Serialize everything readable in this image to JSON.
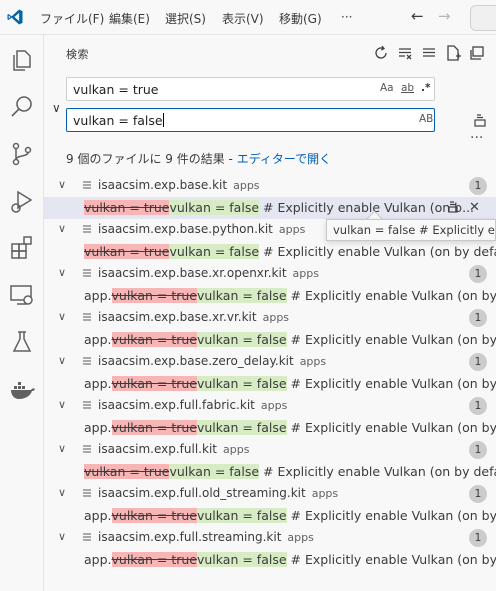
{
  "titlebar": {
    "menu": [
      "ファイル(F)",
      "編集(E)",
      "選択(S)",
      "表示(V)",
      "移動(G)",
      "···"
    ],
    "back_icon": "arrow-left-icon",
    "forward_icon": "arrow-right-icon"
  },
  "activity_bar": [
    "explorer-icon",
    "search-icon",
    "source-control-icon",
    "run-debug-icon",
    "extensions-icon",
    "remote-explorer-icon",
    "testing-icon",
    "docker-icon"
  ],
  "search": {
    "title": "検索",
    "find_value": "vulkan = true",
    "replace_value": "vulkan = false",
    "find_options": [
      "Aa",
      "ab",
      ".*"
    ],
    "replace_options": [
      "AB"
    ],
    "summary_text": "9 個のファイルに 9 件の結果 - ",
    "open_in_editor": "エディターで開く"
  },
  "results": [
    {
      "file": "isaacsim.exp.base.kit",
      "dir": "apps",
      "count": "1",
      "prefix": "",
      "find": "vulkan = true",
      "replace": "vulkan = false",
      "suffix": " # Explicitly enable Vulkan (on b...",
      "selected": true
    },
    {
      "file": "isaacsim.exp.base.python.kit",
      "dir": "apps",
      "count": "1",
      "prefix": "",
      "find": "vulkan = true",
      "replace": "vulkan = false",
      "suffix": " # Explicitly enable Vulkan (on by default o..."
    },
    {
      "file": "isaacsim.exp.base.xr.openxr.kit",
      "dir": "apps",
      "count": "1",
      "prefix": "app.",
      "find": "vulkan = true",
      "replace": "vulkan = false",
      "suffix": " # Explicitly enable Vulkan (on by defa..."
    },
    {
      "file": "isaacsim.exp.base.xr.vr.kit",
      "dir": "apps",
      "count": "1",
      "prefix": "app.",
      "find": "vulkan = true",
      "replace": "vulkan = false",
      "suffix": " # Explicitly enable Vulkan (on by defa..."
    },
    {
      "file": "isaacsim.exp.base.zero_delay.kit",
      "dir": "apps",
      "count": "1",
      "prefix": "app.",
      "find": "vulkan = true",
      "replace": "vulkan = false",
      "suffix": " # Explicitly enable Vulkan (on by defa..."
    },
    {
      "file": "isaacsim.exp.full.fabric.kit",
      "dir": "apps",
      "count": "1",
      "prefix": "app.",
      "find": "vulkan = true",
      "replace": "vulkan = false",
      "suffix": " # Explicitly enable Vulkan (on by defa..."
    },
    {
      "file": "isaacsim.exp.full.kit",
      "dir": "apps",
      "count": "1",
      "prefix": "",
      "find": "vulkan = true",
      "replace": "vulkan = false",
      "suffix": " # Explicitly enable Vulkan (on by default o..."
    },
    {
      "file": "isaacsim.exp.full.old_streaming.kit",
      "dir": "apps",
      "count": "1",
      "prefix": "app.",
      "find": "vulkan = true",
      "replace": "vulkan = false",
      "suffix": " # Explicitly enable Vulkan (on by defa..."
    },
    {
      "file": "isaacsim.exp.full.streaming.kit",
      "dir": "apps",
      "count": "1",
      "prefix": "app.",
      "find": "vulkan = true",
      "replace": "vulkan = false",
      "suffix": " # Explicitly enable Vulkan (on by defa..."
    }
  ],
  "hover_tooltip": "vulkan = false # Explicitly enable Vulkan (on by default on Linux)",
  "colors": {
    "accent": "#005fb8",
    "deleted_bg": "#f8b5b5",
    "inserted_bg": "#d7ecc4",
    "selected_row": "#e4e6f1"
  }
}
